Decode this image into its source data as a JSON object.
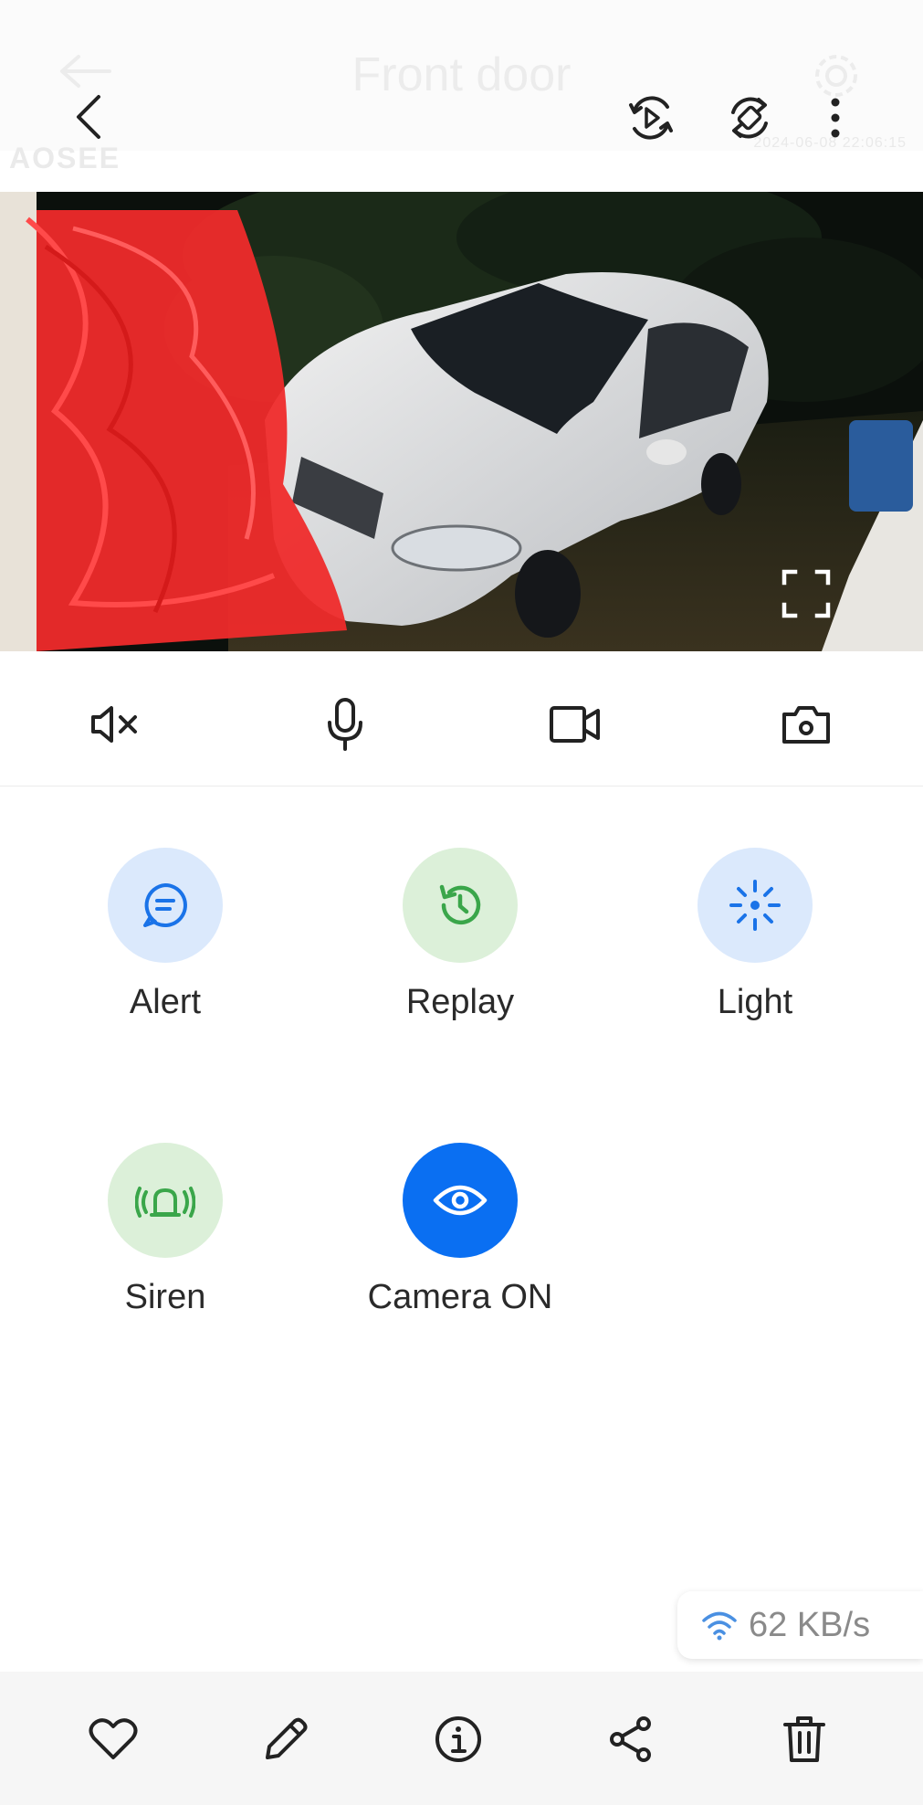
{
  "header": {
    "title": "Front door",
    "back_icon": "chevron-left-icon",
    "actions": [
      "playback-icon",
      "rotate-icon",
      "more-vert-icon"
    ]
  },
  "video": {
    "timestamp": "2024-06-08 22:06:15",
    "watermark": "AOSEE"
  },
  "controls": [
    "mute-icon",
    "microphone-icon",
    "record-video-icon",
    "snapshot-icon"
  ],
  "actions": [
    {
      "label": "Alert",
      "icon": "message-icon",
      "color": "#1a73e8"
    },
    {
      "label": "Replay",
      "icon": "history-icon",
      "color": "#3aa64a"
    },
    {
      "label": "Light",
      "icon": "light-icon",
      "color": "#1a73e8"
    },
    {
      "label": "Siren",
      "icon": "siren-icon",
      "color": "#3aa64a"
    },
    {
      "label": "Camera ON",
      "icon": "eye-icon",
      "color": "#ffffff"
    }
  ],
  "network": {
    "speed": "62 KB/s"
  },
  "bottom_bar": [
    "heart-icon",
    "edit-icon",
    "info-icon",
    "share-icon",
    "delete-icon"
  ]
}
